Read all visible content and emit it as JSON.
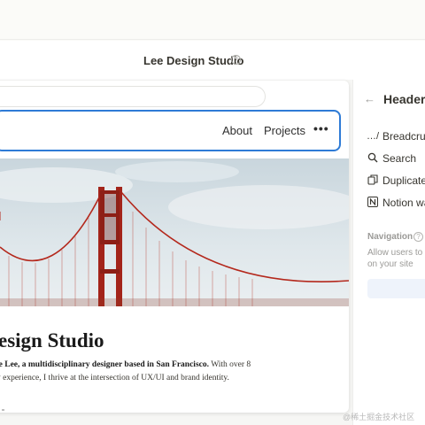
{
  "app": {
    "site_title": "Lee Design Studio",
    "help_glyph": "?"
  },
  "preview": {
    "nav": {
      "about": "About",
      "projects": "Projects",
      "more": "•••"
    },
    "heading": "esign Studio",
    "body_bold": "ie Lee, a multidisciplinary designer based in San Francisco.",
    "body_rest_1": " With over 8",
    "body_line_2": "y experience, I thrive at the intersection of UX/UI and brand identity."
  },
  "panel": {
    "back_glyph": "←",
    "title": "Header",
    "items": [
      {
        "icon": "breadcrumb-icon",
        "glyph": "…/",
        "label": "Breadcrum"
      },
      {
        "icon": "search-icon",
        "glyph": "⌕",
        "label": "Search"
      },
      {
        "icon": "duplicate-icon",
        "glyph": "⧉",
        "label": "Duplicate"
      },
      {
        "icon": "notion-icon",
        "glyph": "N",
        "label": "Notion wa"
      }
    ],
    "navigation_label": "Navigation",
    "navigation_desc": "Allow users to on your site"
  },
  "watermark": "@稀土掘金技术社区",
  "colors": {
    "accent": "#2e7bd6",
    "bridge": "#b4281c",
    "sky": "#dde6ea"
  }
}
